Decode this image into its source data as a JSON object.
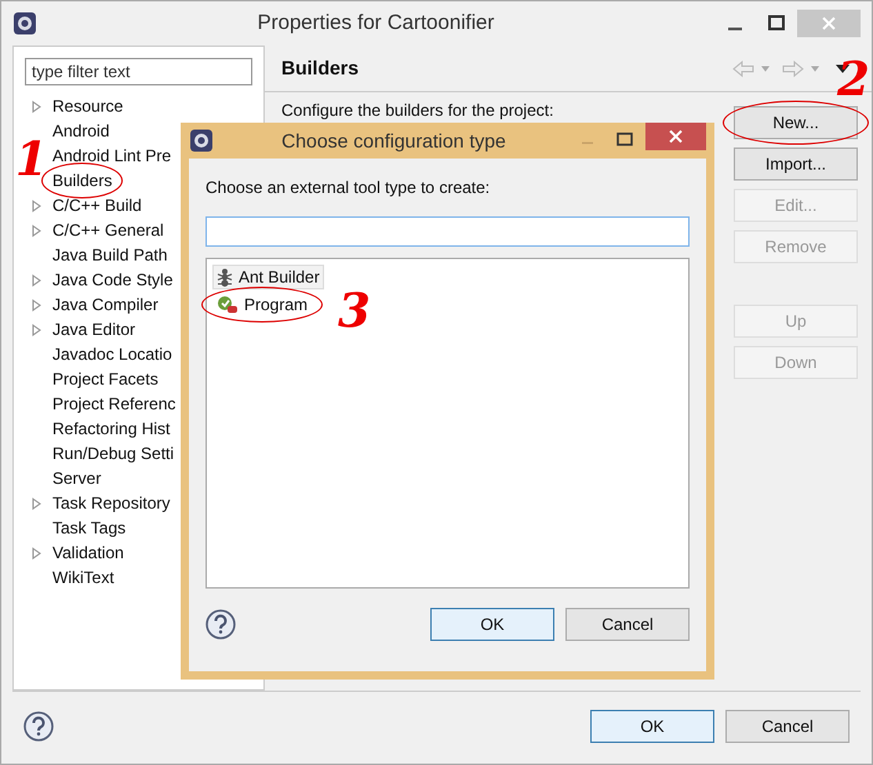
{
  "window": {
    "title": "Properties for Cartoonifier"
  },
  "filter": {
    "placeholder": "type filter text"
  },
  "tree": [
    {
      "label": "Resource",
      "expandable": true,
      "circled": false
    },
    {
      "label": "Android",
      "expandable": false,
      "circled": false
    },
    {
      "label": "Android Lint Pre",
      "expandable": false,
      "circled": false
    },
    {
      "label": "Builders",
      "expandable": false,
      "circled": true
    },
    {
      "label": "C/C++ Build",
      "expandable": true,
      "circled": false
    },
    {
      "label": "C/C++ General",
      "expandable": true,
      "circled": false
    },
    {
      "label": "Java Build Path",
      "expandable": false,
      "circled": false
    },
    {
      "label": "Java Code Style",
      "expandable": true,
      "circled": false
    },
    {
      "label": "Java Compiler",
      "expandable": true,
      "circled": false
    },
    {
      "label": "Java Editor",
      "expandable": true,
      "circled": false
    },
    {
      "label": "Javadoc Locatio",
      "expandable": false,
      "circled": false
    },
    {
      "label": "Project Facets",
      "expandable": false,
      "circled": false
    },
    {
      "label": "Project Referenc",
      "expandable": false,
      "circled": false
    },
    {
      "label": "Refactoring Hist",
      "expandable": false,
      "circled": false
    },
    {
      "label": "Run/Debug Setti",
      "expandable": false,
      "circled": false
    },
    {
      "label": "Server",
      "expandable": false,
      "circled": false
    },
    {
      "label": "Task Repository",
      "expandable": true,
      "circled": false
    },
    {
      "label": "Task Tags",
      "expandable": false,
      "circled": false
    },
    {
      "label": "Validation",
      "expandable": true,
      "circled": false
    },
    {
      "label": "WikiText",
      "expandable": false,
      "circled": false
    }
  ],
  "page": {
    "title": "Builders",
    "description": "Configure the builders for the project:"
  },
  "side_button_groups": [
    {
      "buttons": [
        {
          "label": "New...",
          "disabled": false,
          "circled": true
        },
        {
          "label": "Import...",
          "disabled": false,
          "circled": false
        },
        {
          "label": "Edit...",
          "disabled": true,
          "circled": false
        },
        {
          "label": "Remove",
          "disabled": true,
          "circled": false
        }
      ]
    },
    {
      "buttons": [
        {
          "label": "Up",
          "disabled": true,
          "circled": false
        },
        {
          "label": "Down",
          "disabled": true,
          "circled": false
        }
      ]
    }
  ],
  "footer": {
    "buttons": [
      {
        "label": "OK",
        "default": true
      },
      {
        "label": "Cancel",
        "default": false
      }
    ]
  },
  "dialog": {
    "title": "Choose configuration type",
    "prompt": "Choose an external tool type to create:",
    "items": [
      {
        "label": "Ant Builder",
        "kind": "ant",
        "selected": true,
        "circled": false
      },
      {
        "label": "Program",
        "kind": "program",
        "selected": false,
        "circled": true
      }
    ],
    "buttons": [
      {
        "label": "OK",
        "default": true
      },
      {
        "label": "Cancel",
        "default": false
      }
    ]
  },
  "annotations": [
    {
      "text": "1",
      "kind": "tree"
    },
    {
      "text": "2",
      "kind": "button"
    },
    {
      "text": "3",
      "kind": "list"
    }
  ]
}
